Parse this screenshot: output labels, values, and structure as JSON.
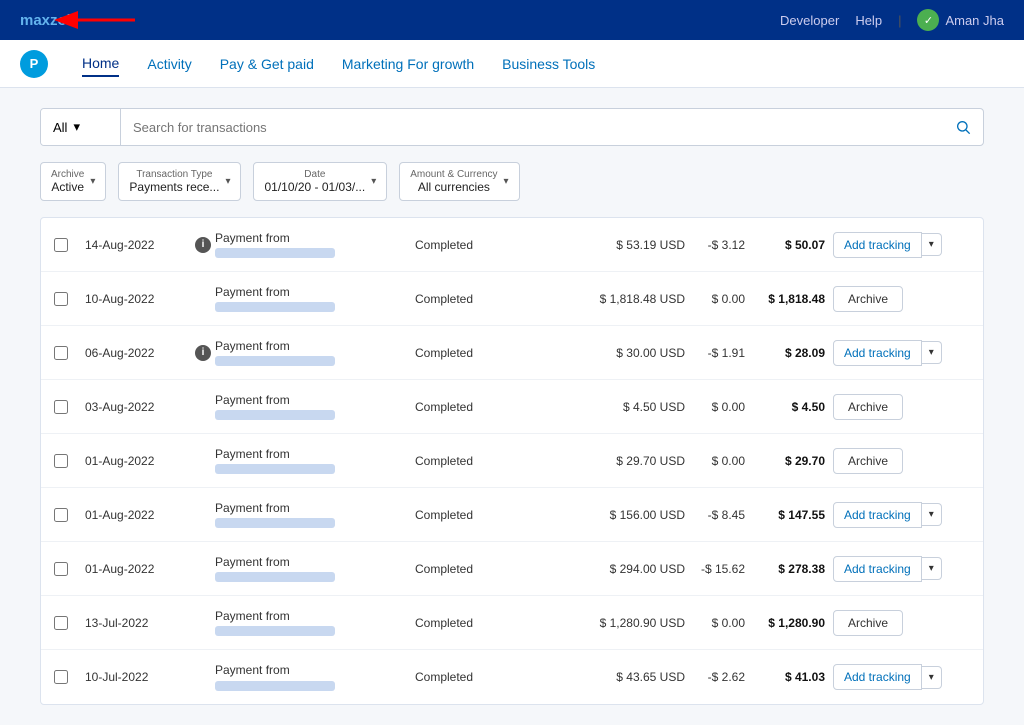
{
  "topBar": {
    "brand": "maxzob",
    "links": [
      "Developer",
      "Help"
    ],
    "divider": "|",
    "user": {
      "initials": "✓",
      "name": "Aman Jha"
    }
  },
  "secondaryNav": {
    "items": [
      "Home",
      "Activity",
      "Pay & Get paid",
      "Marketing For growth",
      "Business Tools"
    ],
    "active": "Home"
  },
  "searchBar": {
    "dropdownValue": "All",
    "placeholder": "Search for transactions"
  },
  "filters": {
    "archive": {
      "label": "Archive",
      "value": "Active"
    },
    "transactionType": {
      "label": "Transaction Type",
      "value": "Payments rece..."
    },
    "date": {
      "label": "Date",
      "value": "01/10/20 - 01/03/..."
    },
    "amountCurrency": {
      "label": "Amount & Currency",
      "value": "All currencies"
    }
  },
  "transactions": [
    {
      "date": "14-Aug-2022",
      "hasInfo": true,
      "description": "Payment from",
      "status": "Completed",
      "amount": "$ 53.19 USD",
      "fee": "-$ 3.12",
      "net": "$ 50.07",
      "actionType": "tracking",
      "actionLabel": "Add tracking"
    },
    {
      "date": "10-Aug-2022",
      "hasInfo": false,
      "description": "Payment from",
      "status": "Completed",
      "amount": "$ 1,818.48 USD",
      "fee": "$ 0.00",
      "net": "$ 1,818.48",
      "actionType": "archive",
      "actionLabel": "Archive"
    },
    {
      "date": "06-Aug-2022",
      "hasInfo": true,
      "description": "Payment from",
      "status": "Completed",
      "amount": "$ 30.00 USD",
      "fee": "-$ 1.91",
      "net": "$ 28.09",
      "actionType": "tracking",
      "actionLabel": "Add tracking"
    },
    {
      "date": "03-Aug-2022",
      "hasInfo": false,
      "description": "Payment from",
      "status": "Completed",
      "amount": "$ 4.50 USD",
      "fee": "$ 0.00",
      "net": "$ 4.50",
      "actionType": "archive",
      "actionLabel": "Archive"
    },
    {
      "date": "01-Aug-2022",
      "hasInfo": false,
      "description": "Payment from",
      "status": "Completed",
      "amount": "$ 29.70 USD",
      "fee": "$ 0.00",
      "net": "$ 29.70",
      "actionType": "archive",
      "actionLabel": "Archive"
    },
    {
      "date": "01-Aug-2022",
      "hasInfo": false,
      "description": "Payment from",
      "status": "Completed",
      "amount": "$ 156.00 USD",
      "fee": "-$ 8.45",
      "net": "$ 147.55",
      "actionType": "tracking",
      "actionLabel": "Add tracking"
    },
    {
      "date": "01-Aug-2022",
      "hasInfo": false,
      "description": "Payment from",
      "status": "Completed",
      "amount": "$ 294.00 USD",
      "fee": "-$ 15.62",
      "net": "$ 278.38",
      "actionType": "tracking",
      "actionLabel": "Add tracking"
    },
    {
      "date": "13-Jul-2022",
      "hasInfo": false,
      "description": "Payment from",
      "status": "Completed",
      "amount": "$ 1,280.90 USD",
      "fee": "$ 0.00",
      "net": "$ 1,280.90",
      "actionType": "archive",
      "actionLabel": "Archive"
    },
    {
      "date": "10-Jul-2022",
      "hasInfo": false,
      "description": "Payment from",
      "status": "Completed",
      "amount": "$ 43.65 USD",
      "fee": "-$ 2.62",
      "net": "$ 41.03",
      "actionType": "tracking",
      "actionLabel": "Add tracking"
    }
  ]
}
